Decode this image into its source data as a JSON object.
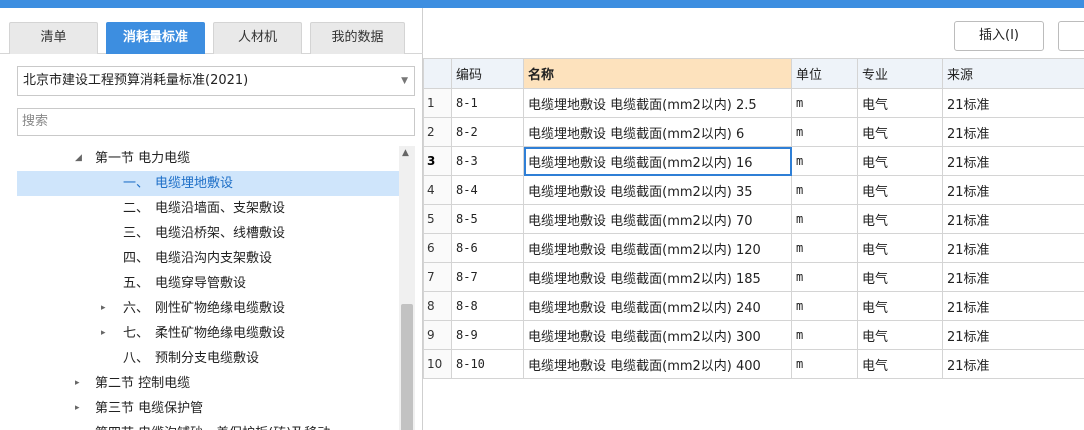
{
  "tabs": [
    "清单",
    "消耗量标准",
    "人材机",
    "我的数据"
  ],
  "active_tab": 1,
  "library_select": {
    "value": "北京市建设工程预算消耗量标准(2021)"
  },
  "search": {
    "placeholder": "搜索"
  },
  "tree": [
    {
      "num": "",
      "label": "第一节 电力电缆",
      "toggle": "◢",
      "selected": false
    },
    {
      "num": "一、",
      "label": "电缆埋地敷设",
      "toggle": "",
      "selected": true
    },
    {
      "num": "二、",
      "label": "电缆沿墙面、支架敷设",
      "toggle": "",
      "selected": false
    },
    {
      "num": "三、",
      "label": "电缆沿桥架、线槽敷设",
      "toggle": "",
      "selected": false
    },
    {
      "num": "四、",
      "label": "电缆沿沟内支架敷设",
      "toggle": "",
      "selected": false
    },
    {
      "num": "五、",
      "label": "电缆穿导管敷设",
      "toggle": "",
      "selected": false
    },
    {
      "num": "六、",
      "label": "刚性矿物绝缘电缆敷设",
      "toggle": "▸",
      "selected": false
    },
    {
      "num": "七、",
      "label": "柔性矿物绝缘电缆敷设",
      "toggle": "▸",
      "selected": false
    },
    {
      "num": "八、",
      "label": "预制分支电缆敷设",
      "toggle": "",
      "selected": false
    },
    {
      "num": "",
      "label": "第二节 控制电缆",
      "toggle": "▸",
      "selected": false
    },
    {
      "num": "",
      "label": "第三节 电缆保护管",
      "toggle": "▸",
      "selected": false
    },
    {
      "num": "",
      "label": "第四节 电缆沟铺砂、盖保护板(砖)及移动",
      "toggle": "",
      "selected": false
    }
  ],
  "toolbar": {
    "insert_label": "插入(I)"
  },
  "table": {
    "headers": [
      "",
      "编码",
      "名称",
      "单位",
      "专业",
      "来源"
    ],
    "rows": [
      {
        "n": "1",
        "code": "8-1",
        "name": "电缆埋地敷设 电缆截面(mm2以内) 2.5",
        "unit": "m",
        "major": "电气",
        "source": "21标准"
      },
      {
        "n": "2",
        "code": "8-2",
        "name": "电缆埋地敷设 电缆截面(mm2以内) 6",
        "unit": "m",
        "major": "电气",
        "source": "21标准"
      },
      {
        "n": "3",
        "code": "8-3",
        "name": "电缆埋地敷设 电缆截面(mm2以内) 16",
        "unit": "m",
        "major": "电气",
        "source": "21标准"
      },
      {
        "n": "4",
        "code": "8-4",
        "name": "电缆埋地敷设 电缆截面(mm2以内) 35",
        "unit": "m",
        "major": "电气",
        "source": "21标准"
      },
      {
        "n": "5",
        "code": "8-5",
        "name": "电缆埋地敷设 电缆截面(mm2以内) 70",
        "unit": "m",
        "major": "电气",
        "source": "21标准"
      },
      {
        "n": "6",
        "code": "8-6",
        "name": "电缆埋地敷设 电缆截面(mm2以内) 120",
        "unit": "m",
        "major": "电气",
        "source": "21标准"
      },
      {
        "n": "7",
        "code": "8-7",
        "name": "电缆埋地敷设 电缆截面(mm2以内) 185",
        "unit": "m",
        "major": "电气",
        "source": "21标准"
      },
      {
        "n": "8",
        "code": "8-8",
        "name": "电缆埋地敷设 电缆截面(mm2以内) 240",
        "unit": "m",
        "major": "电气",
        "source": "21标准"
      },
      {
        "n": "9",
        "code": "8-9",
        "name": "电缆埋地敷设 电缆截面(mm2以内) 300",
        "unit": "m",
        "major": "电气",
        "source": "21标准"
      },
      {
        "n": "10",
        "code": "8-10",
        "name": "电缆埋地敷设 电缆截面(mm2以内) 400",
        "unit": "m",
        "major": "电气",
        "source": "21标准"
      }
    ],
    "current_row": 2
  },
  "colors": {
    "accent": "#3d8ee0",
    "selected_bg": "#cfe5fb",
    "header_name_bg": "#fde2bd"
  }
}
